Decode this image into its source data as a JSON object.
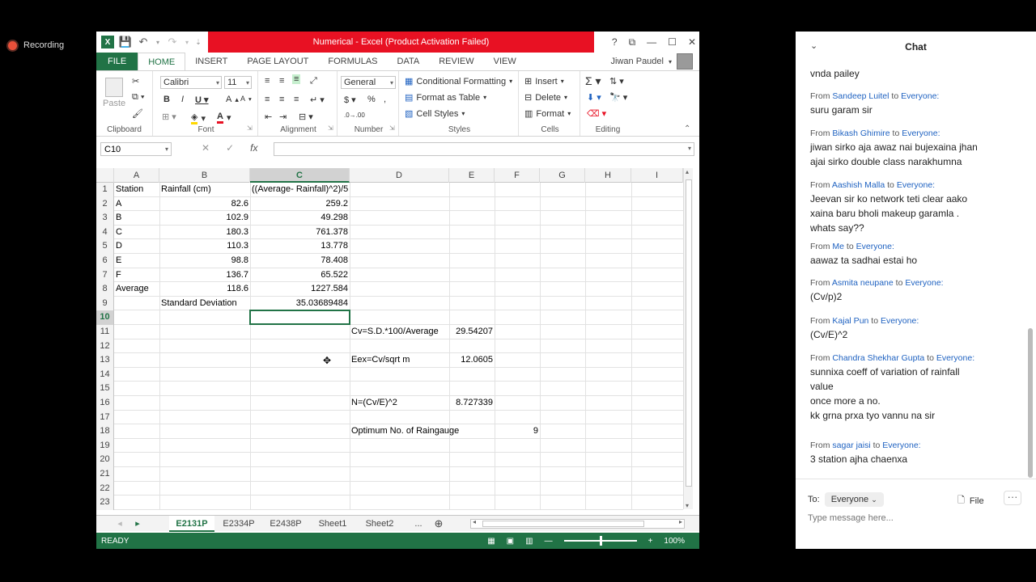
{
  "recording": {
    "label": "Recording"
  },
  "excel": {
    "title": "Numerical -  Excel (Product Activation Failed)",
    "window_buttons": [
      "?",
      "⧉",
      "—",
      "☐",
      "✕"
    ],
    "tabs": [
      "FILE",
      "HOME",
      "INSERT",
      "PAGE LAYOUT",
      "FORMULAS",
      "DATA",
      "REVIEW",
      "VIEW"
    ],
    "active_tab": "HOME",
    "user": "Jiwan Paudel",
    "ribbon": {
      "clipboard": {
        "label": "Clipboard",
        "paste": "Paste"
      },
      "font": {
        "label": "Font",
        "name": "Calibri",
        "size": "11"
      },
      "alignment": {
        "label": "Alignment"
      },
      "number": {
        "label": "Number",
        "format": "General"
      },
      "styles": {
        "label": "Styles",
        "conditional": "Conditional Formatting",
        "format_table": "Format as Table",
        "cell_styles": "Cell Styles"
      },
      "cells": {
        "label": "Cells",
        "insert": "Insert",
        "delete": "Delete",
        "format": "Format"
      },
      "editing": {
        "label": "Editing"
      }
    },
    "name_box": "C10",
    "formula": "",
    "columns": [
      "A",
      "B",
      "C",
      "D",
      "E",
      "F",
      "G",
      "H",
      "I"
    ],
    "selected_column": "C",
    "selected_row": "10",
    "rows": [
      {
        "n": "1",
        "A": "Station",
        "B": "Rainfall (cm)",
        "C": "((Average- Rainfall)^2)/5",
        "D": "",
        "E": "",
        "F": ""
      },
      {
        "n": "2",
        "A": "A",
        "B": "82.6",
        "C": "259.2",
        "D": "",
        "E": "",
        "F": ""
      },
      {
        "n": "3",
        "A": "B",
        "B": "102.9",
        "C": "49.298",
        "D": "",
        "E": "",
        "F": ""
      },
      {
        "n": "4",
        "A": "C",
        "B": "180.3",
        "C": "761.378",
        "D": "",
        "E": "",
        "F": ""
      },
      {
        "n": "5",
        "A": "D",
        "B": "110.3",
        "C": "13.778",
        "D": "",
        "E": "",
        "F": ""
      },
      {
        "n": "6",
        "A": "E",
        "B": "98.8",
        "C": "78.408",
        "D": "",
        "E": "",
        "F": ""
      },
      {
        "n": "7",
        "A": "F",
        "B": "136.7",
        "C": "65.522",
        "D": "",
        "E": "",
        "F": ""
      },
      {
        "n": "8",
        "A": "Average",
        "B": "118.6",
        "C": "1227.584",
        "D": "",
        "E": "",
        "F": ""
      },
      {
        "n": "9",
        "A": "",
        "B": "Standard Deviation",
        "C": "35.03689484",
        "D": "",
        "E": "",
        "F": ""
      },
      {
        "n": "10",
        "A": "",
        "B": "",
        "C": "",
        "D": "",
        "E": "",
        "F": ""
      },
      {
        "n": "11",
        "A": "",
        "B": "",
        "C": "",
        "D": "Cv=S.D.*100/Average",
        "E": "29.54207",
        "F": ""
      },
      {
        "n": "12",
        "A": "",
        "B": "",
        "C": "",
        "D": "",
        "E": "",
        "F": ""
      },
      {
        "n": "13",
        "A": "",
        "B": "",
        "C": "",
        "D": "Eex=Cv/sqrt m",
        "E": "12.0605",
        "F": ""
      },
      {
        "n": "14",
        "A": "",
        "B": "",
        "C": "",
        "D": "",
        "E": "",
        "F": ""
      },
      {
        "n": "15",
        "A": "",
        "B": "",
        "C": "",
        "D": "",
        "E": "",
        "F": ""
      },
      {
        "n": "16",
        "A": "",
        "B": "",
        "C": "",
        "D": "N=(Cv/E)^2",
        "E": "8.727339",
        "F": ""
      },
      {
        "n": "17",
        "A": "",
        "B": "",
        "C": "",
        "D": "",
        "E": "",
        "F": ""
      },
      {
        "n": "18",
        "A": "",
        "B": "",
        "C": "",
        "D": "Optimum No. of Raingauge",
        "E": "",
        "F": "9"
      },
      {
        "n": "19",
        "A": "",
        "B": "",
        "C": "",
        "D": "",
        "E": "",
        "F": ""
      },
      {
        "n": "20",
        "A": "",
        "B": "",
        "C": "",
        "D": "",
        "E": "",
        "F": ""
      },
      {
        "n": "21",
        "A": "",
        "B": "",
        "C": "",
        "D": "",
        "E": "",
        "F": ""
      },
      {
        "n": "22",
        "A": "",
        "B": "",
        "C": "",
        "D": "",
        "E": "",
        "F": ""
      },
      {
        "n": "23",
        "A": "",
        "B": "",
        "C": "",
        "D": "",
        "E": "",
        "F": ""
      }
    ],
    "sheets": [
      "E2131P",
      "E2334P",
      "E2438P",
      "Sheet1",
      "Sheet2",
      "..."
    ],
    "active_sheet": "E2131P",
    "status": "READY",
    "zoom": "100%"
  },
  "chat": {
    "title": "Chat",
    "messages": [
      {
        "from": "",
        "to": "",
        "lines": [
          "vnda pailey"
        ]
      },
      {
        "from": "Sandeep Luitel",
        "to": "Everyone:",
        "lines": [
          "suru garam sir"
        ]
      },
      {
        "from": "Bikash Ghimire",
        "to": "Everyone:",
        "lines": [
          "jiwan sirko aja awaz nai bujexaina jhan",
          "ajai sirko double class narakhumna"
        ]
      },
      {
        "from": "Aashish Malla",
        "to": "Everyone:",
        "lines": [
          "Jeevan sir ko network teti clear aako",
          "xaina baru bholi  makeup garamla .",
          "whats say??"
        ]
      },
      {
        "from": "Me",
        "to": "Everyone:",
        "lines": [
          "aawaz ta sadhai estai ho"
        ]
      },
      {
        "from": "Asmita neupane",
        "to": "Everyone:",
        "lines": [
          "(Cv/p)2"
        ]
      },
      {
        "from": "Kajal Pun",
        "to": "Everyone:",
        "lines": [
          "(Cv/E)^2"
        ]
      },
      {
        "from": "Chandra Shekhar Gupta",
        "to": "Everyone:",
        "lines": [
          "sunnixa coeff of variation of rainfall",
          "value",
          "once more a no.",
          "kk grna prxa tyo vannu na sir"
        ]
      },
      {
        "from": "sagar jaisi",
        "to": "Everyone:",
        "lines": [
          "3 station ajha chaenxa"
        ]
      }
    ],
    "to_label": "To:",
    "recipient": "Everyone",
    "file_label": "File",
    "input_placeholder": "Type message here..."
  }
}
